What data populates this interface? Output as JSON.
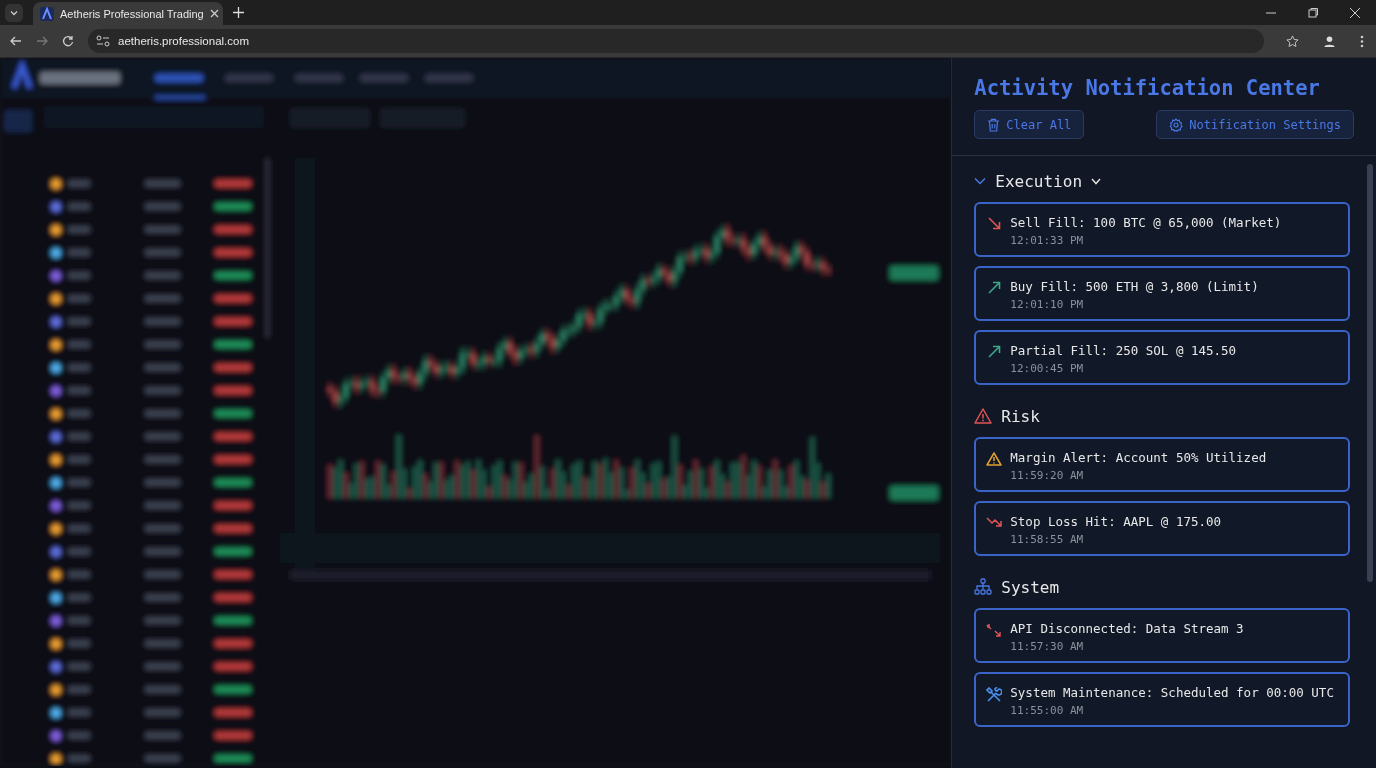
{
  "browser": {
    "tab_title": "Aetheris Professional Trading",
    "url": "aetheris.professional.com"
  },
  "panel": {
    "title": "Activity Notification Center",
    "buttons": [
      {
        "kind": "clear",
        "label": "Clear All"
      },
      {
        "kind": "settings",
        "label": "Notification Settings"
      }
    ],
    "sections": [
      {
        "kind": "execution",
        "title": "Execution",
        "items": [
          {
            "kind": "sell",
            "text": "Sell Fill: 100 BTC @ 65,000 (Market)",
            "time": "12:01:33 PM"
          },
          {
            "kind": "buy",
            "text": "Buy Fill: 500 ETH @ 3,800 (Limit)",
            "time": "12:01:10 PM"
          },
          {
            "kind": "buy",
            "text": "Partial Fill: 250 SOL @ 145.50",
            "time": "12:00:45 PM"
          }
        ]
      },
      {
        "kind": "risk",
        "title": "Risk",
        "items": [
          {
            "kind": "margin",
            "text": "Margin Alert: Account 50% Utilized",
            "time": "11:59:20 AM"
          },
          {
            "kind": "stoploss",
            "text": "Stop Loss Hit: AAPL @ 175.00",
            "time": "11:58:55 AM"
          }
        ]
      },
      {
        "kind": "system",
        "title": "System",
        "items": [
          {
            "kind": "disconnect",
            "text": "API Disconnected: Data Stream 3",
            "time": "11:57:30 AM"
          },
          {
            "kind": "maintenance",
            "text": "System Maintenance: Scheduled for 00:00 UTC",
            "time": "11:55:00 AM"
          }
        ]
      }
    ]
  }
}
